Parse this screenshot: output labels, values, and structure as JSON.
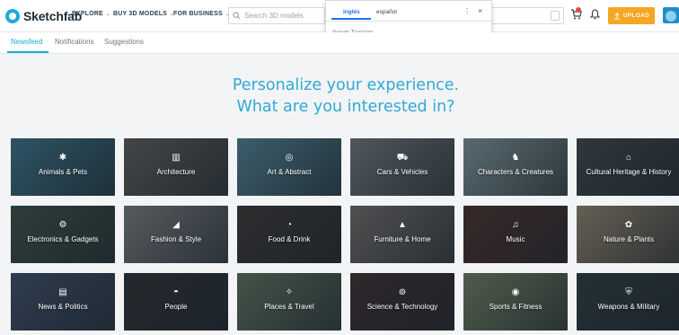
{
  "brand": {
    "name": "Sketchfab"
  },
  "nav": {
    "explore": "EXPLORE",
    "buy": "BUY 3D MODELS",
    "business": "FOR BUSINESS"
  },
  "search": {
    "placeholder": "Search 3D models"
  },
  "actions": {
    "upload": "UPLOAD"
  },
  "translate_popup": {
    "tab_source": "inglés",
    "tab_target": "español",
    "brand": "Google Translate",
    "more": "⋮",
    "close": "×"
  },
  "subnav": {
    "tabs": [
      "Newsfeed",
      "Notifications",
      "Suggestions"
    ]
  },
  "headline": {
    "line1": "Personalize your experience.",
    "line2": "What are you interested in?"
  },
  "categories": [
    {
      "label": "Animals & Pets",
      "icon": "bug-icon",
      "glyph": "✱",
      "color": "#3a6f82"
    },
    {
      "label": "Architecture",
      "icon": "building-icon",
      "glyph": "▥",
      "color": "#5a5a56"
    },
    {
      "label": "Art & Abstract",
      "icon": "spiral-icon",
      "glyph": "◎",
      "color": "#4f7d8c"
    },
    {
      "label": "Cars & Vehicles",
      "icon": "car-icon",
      "glyph": "⛟",
      "color": "#6e7276"
    },
    {
      "label": "Characters & Creatures",
      "icon": "character-icon",
      "glyph": "♞",
      "color": "#7b9094"
    },
    {
      "label": "Cultural Heritage & History",
      "icon": "museum-icon",
      "glyph": "⌂",
      "color": "#3f4446"
    },
    {
      "label": "Electronics & Gadgets",
      "icon": "chip-icon",
      "glyph": "⚙",
      "color": "#3a4e44"
    },
    {
      "label": "Fashion & Style",
      "icon": "shoe-icon",
      "glyph": "◢",
      "color": "#77797a"
    },
    {
      "label": "Food & Drink",
      "icon": "food-icon",
      "glyph": "◔",
      "color": "#3a3634"
    },
    {
      "label": "Furniture & Home",
      "icon": "lamp-icon",
      "glyph": "▲",
      "color": "#6d6a66"
    },
    {
      "label": "Music",
      "icon": "headphones-icon",
      "glyph": "♫",
      "color": "#4a2f2a"
    },
    {
      "label": "Nature & Plants",
      "icon": "flower-icon",
      "glyph": "✿",
      "color": "#8c7f6a"
    },
    {
      "label": "News & Politics",
      "icon": "news-icon",
      "glyph": "▤",
      "color": "#3c4d63"
    },
    {
      "label": "People",
      "icon": "sunglasses-icon",
      "glyph": "◓",
      "color": "#2e3033"
    },
    {
      "label": "Places & Travel",
      "icon": "compass-icon",
      "glyph": "✧",
      "color": "#5c6e5a"
    },
    {
      "label": "Science & Technology",
      "icon": "atom-icon",
      "glyph": "⊚",
      "color": "#3b2e2f"
    },
    {
      "label": "Sports & Fitness",
      "icon": "ball-icon",
      "glyph": "◉",
      "color": "#6c7b5d"
    },
    {
      "label": "Weapons & Military",
      "icon": "shield-icon",
      "glyph": "⛨",
      "color": "#2e3a3e"
    }
  ]
}
